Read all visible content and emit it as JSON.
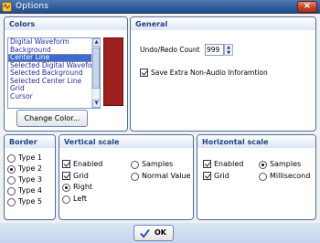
{
  "window": {
    "title": "Options",
    "close_glyph": "×"
  },
  "colors_panel": {
    "title": "Colors",
    "items": [
      "Digital Waveform",
      "Background",
      "Center Line",
      "Selected  Digital Waveform",
      "Selected Background",
      "Selected Center Line",
      "Grid",
      "Cursor"
    ],
    "selected_index": 2,
    "swatch_color": "#9d1f1f",
    "change_button": "Change Color..."
  },
  "general_panel": {
    "title": "General",
    "undo_label": "Undo/Redo Count",
    "undo_value": "999",
    "extra_label": "Save Extra Non-Audio Inforamtion",
    "extra_checked": true
  },
  "border_panel": {
    "title": "Border",
    "options": [
      "Type 1",
      "Type 2",
      "Type 3",
      "Type 4",
      "Type 5"
    ],
    "selected": "Type 2"
  },
  "vertical_panel": {
    "title": "Vertical scale",
    "enabled_label": "Enabled",
    "grid_label": "Grid",
    "right_label": "Right",
    "left_label": "Left",
    "samples_label": "Samples",
    "normal_label": "Normal Value"
  },
  "horizontal_panel": {
    "title": "Horizontal scale",
    "enabled_label": "Enabled",
    "grid_label": "Grid",
    "samples_label": "Samples",
    "millisecond_label": "Millisecond"
  },
  "footer": {
    "ok_label": "OK"
  }
}
